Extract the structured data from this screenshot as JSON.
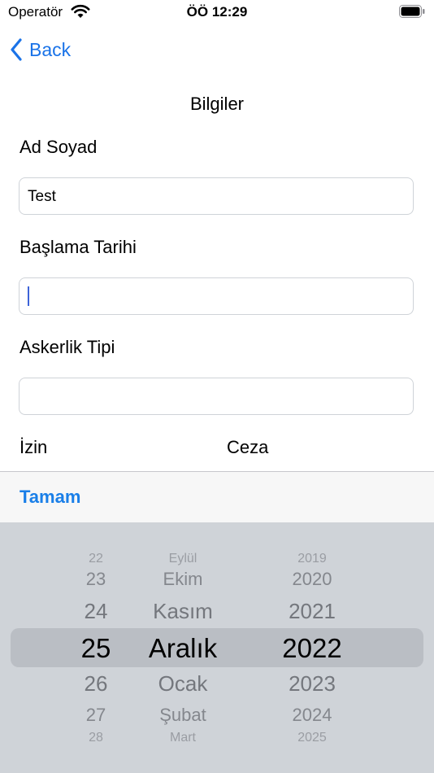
{
  "status_bar": {
    "carrier": "Operatör",
    "time": "ÖÖ 12:29"
  },
  "nav": {
    "back_label": "Back"
  },
  "form": {
    "title": "Bilgiler",
    "name_label": "Ad Soyad",
    "name_value": "Test",
    "start_date_label": "Başlama Tarihi",
    "start_date_value": "",
    "service_type_label": "Askerlik Tipi",
    "service_type_value": "",
    "leave_label": "İzin",
    "penalty_label": "Ceza"
  },
  "toolbar": {
    "done_label": "Tamam"
  },
  "date_picker": {
    "days": [
      "22",
      "23",
      "24",
      "25",
      "26",
      "27",
      "28"
    ],
    "months": [
      "Eylül",
      "Ekim",
      "Kasım",
      "Aralık",
      "Ocak",
      "Şubat",
      "Mart"
    ],
    "years": [
      "2019",
      "2020",
      "2021",
      "2022",
      "2023",
      "2024",
      "2025"
    ],
    "selected": {
      "day": "25",
      "month": "Aralık",
      "year": "2022"
    }
  },
  "colors": {
    "accent": "#1a7fe8",
    "caret": "#3d63d8",
    "picker_bg": "#cfd3d8"
  }
}
